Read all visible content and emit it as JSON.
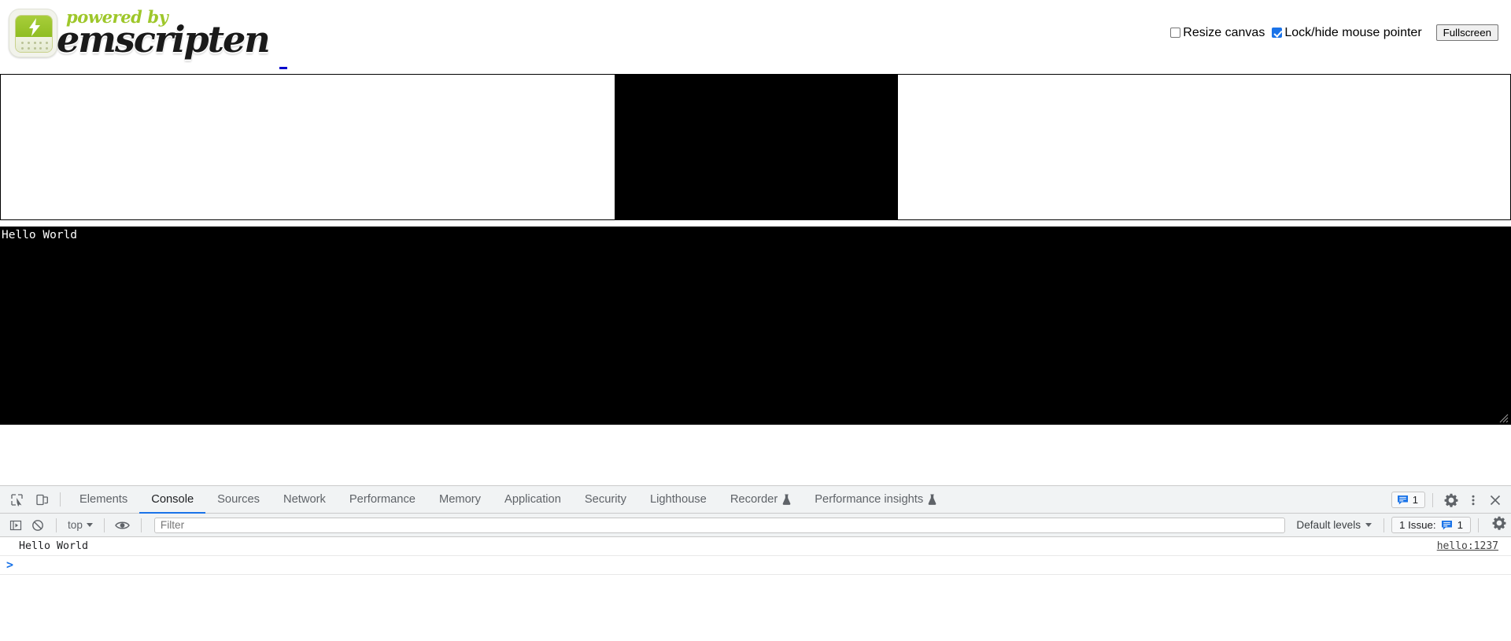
{
  "shell": {
    "logo": {
      "powered_by": "powered by",
      "wordmark": "emscripten",
      "icon_name": "emscripten-logo"
    },
    "controls": {
      "resize_canvas_label": "Resize canvas",
      "resize_canvas_checked": false,
      "lock_pointer_label": "Lock/hide mouse pointer",
      "lock_pointer_checked": true,
      "fullscreen_label": "Fullscreen"
    },
    "output": {
      "text": "Hello World"
    }
  },
  "devtools": {
    "tabs": [
      {
        "label": "Elements",
        "active": false,
        "experimental": false
      },
      {
        "label": "Console",
        "active": true,
        "experimental": false
      },
      {
        "label": "Sources",
        "active": false,
        "experimental": false
      },
      {
        "label": "Network",
        "active": false,
        "experimental": false
      },
      {
        "label": "Performance",
        "active": false,
        "experimental": false
      },
      {
        "label": "Memory",
        "active": false,
        "experimental": false
      },
      {
        "label": "Application",
        "active": false,
        "experimental": false
      },
      {
        "label": "Security",
        "active": false,
        "experimental": false
      },
      {
        "label": "Lighthouse",
        "active": false,
        "experimental": false
      },
      {
        "label": "Recorder",
        "active": false,
        "experimental": true
      },
      {
        "label": "Performance insights",
        "active": false,
        "experimental": true
      }
    ],
    "tabbar_right": {
      "issues_count": "1",
      "settings_icon": "gear-icon",
      "more_icon": "kebab-menu-icon",
      "close_icon": "close-icon"
    },
    "console_toolbar": {
      "sidebar_icon": "console-sidebar-icon",
      "clear_icon": "clear-console-icon",
      "context_value": "top",
      "live_expression_icon": "eye-icon",
      "filter_placeholder": "Filter",
      "filter_value": "",
      "levels_value": "Default levels",
      "issues_label": "1 Issue:",
      "issues_count": "1",
      "settings_icon": "gear-icon"
    },
    "messages": [
      {
        "text": "Hello World",
        "source": "hello:1237"
      }
    ],
    "prompt": ">"
  },
  "colors": {
    "accent_blue": "#1a73e8",
    "emscripten_green": "#9ec72a",
    "canvas_black": "#000000",
    "devtools_bg": "#f1f3f4"
  }
}
